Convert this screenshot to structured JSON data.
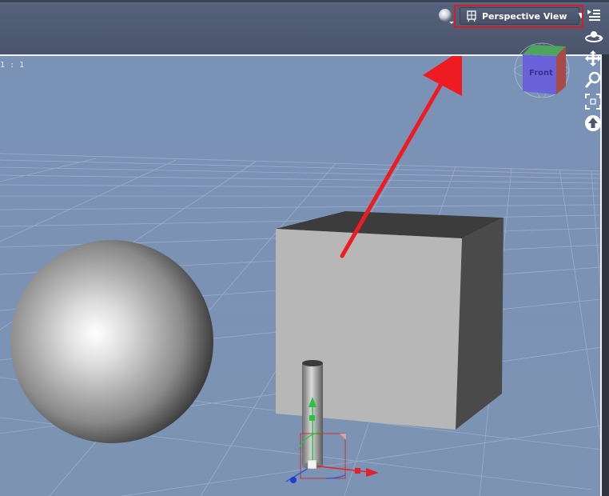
{
  "toolbar": {
    "view_label": "Perspective View",
    "dropdown_arrow": "▼",
    "view_icon": "camera-grid-icon",
    "render_icon": "render-sphere-icon"
  },
  "viewport": {
    "aspect_label": "1 : 1",
    "background_color": "#7d94b7",
    "highlight_color": "#d81a22",
    "annotation_color": "#ee1b23",
    "nav_cube_face_label": "Front"
  },
  "side_tools": [
    {
      "name": "pane-options-icon"
    },
    {
      "name": "orbit-icon"
    },
    {
      "name": "translate-icon"
    },
    {
      "name": "zoom-icon"
    },
    {
      "name": "frame-icon"
    },
    {
      "name": "reset-view-icon"
    }
  ]
}
